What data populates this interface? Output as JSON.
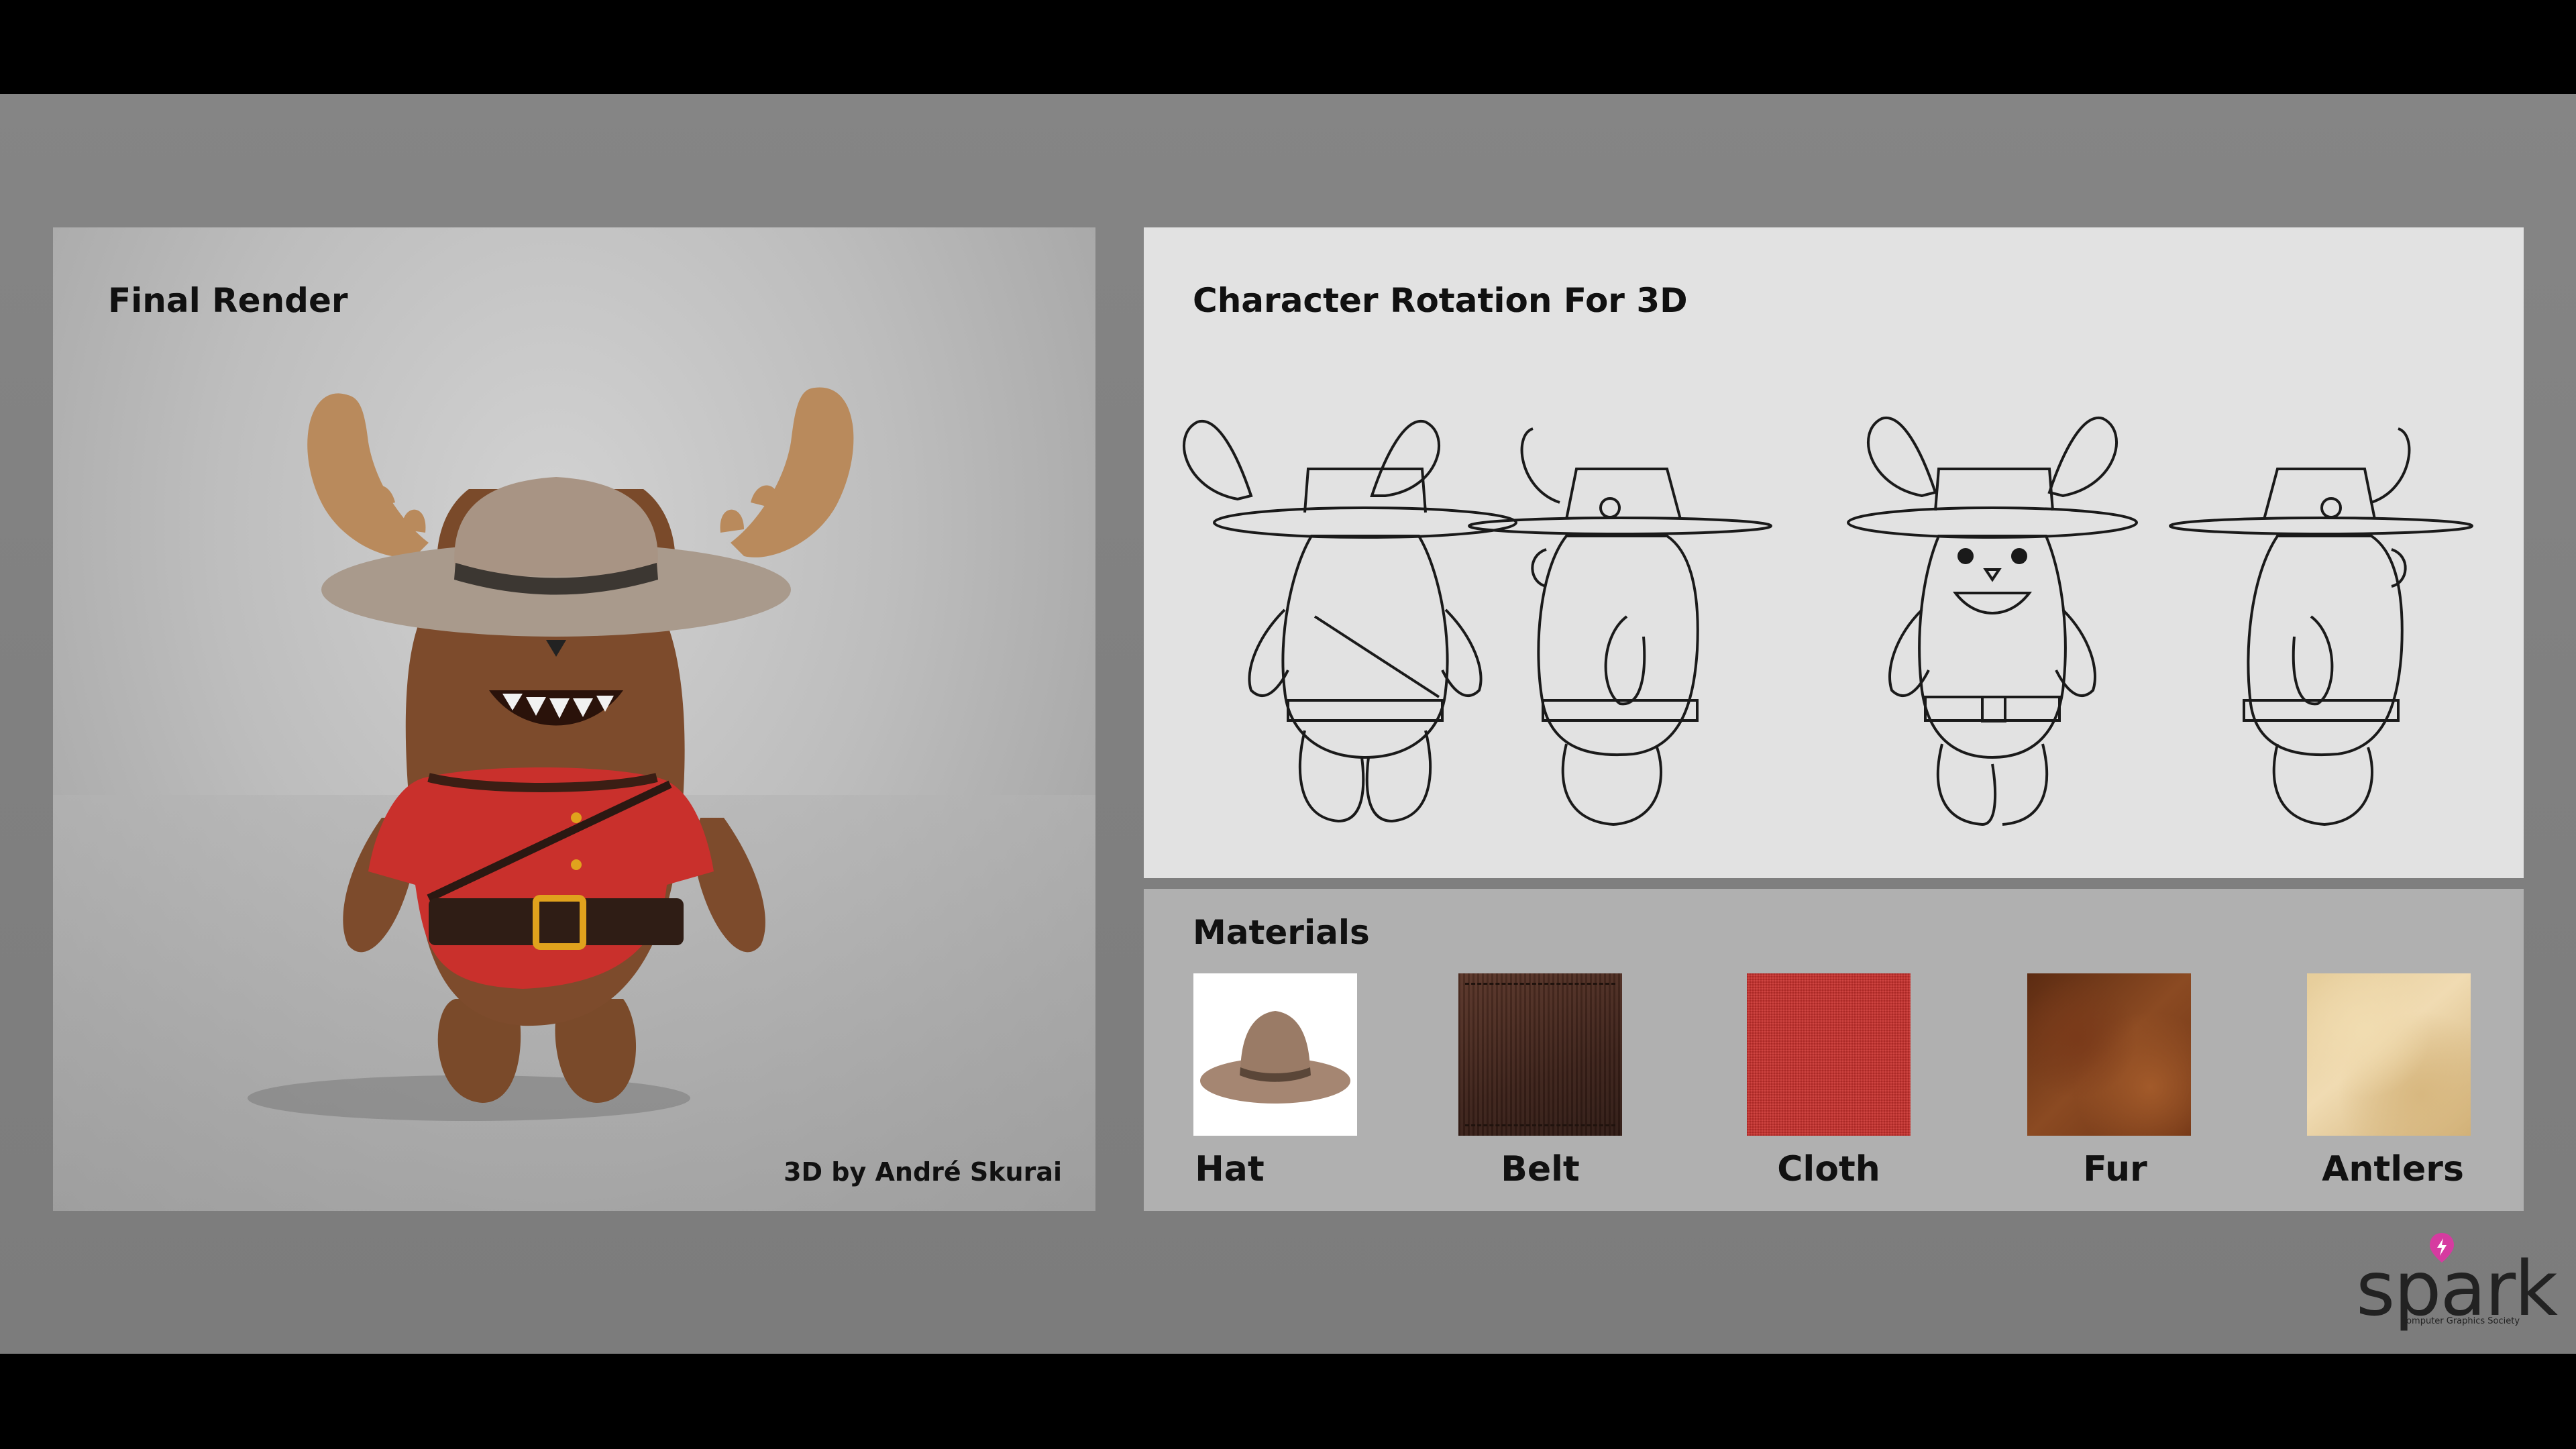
{
  "final_render": {
    "title": "Final Render",
    "credit": "3D by André Skurai"
  },
  "rotation": {
    "title": "Character Rotation For 3D",
    "views": [
      "back",
      "right-side",
      "front",
      "left-side"
    ]
  },
  "materials": {
    "title": "Materials",
    "items": [
      {
        "label": "Hat",
        "color": "#a98b78"
      },
      {
        "label": "Belt",
        "color": "#4a2a1f"
      },
      {
        "label": "Cloth",
        "color": "#c9302c"
      },
      {
        "label": "Fur",
        "color": "#7a3a1a"
      },
      {
        "label": "Antlers",
        "color": "#e6cd9a"
      }
    ]
  },
  "logo": {
    "word": "spark",
    "tagline": "Computer Graphics Society",
    "accent": "#d63ba0"
  },
  "colors": {
    "background": "#808080",
    "letterbox": "#000000",
    "rotation_panel": "#e2e2e2",
    "materials_panel": "#b0b0b0",
    "jacket_red": "#c9302c",
    "fur_brown": "#7a4a2a"
  }
}
